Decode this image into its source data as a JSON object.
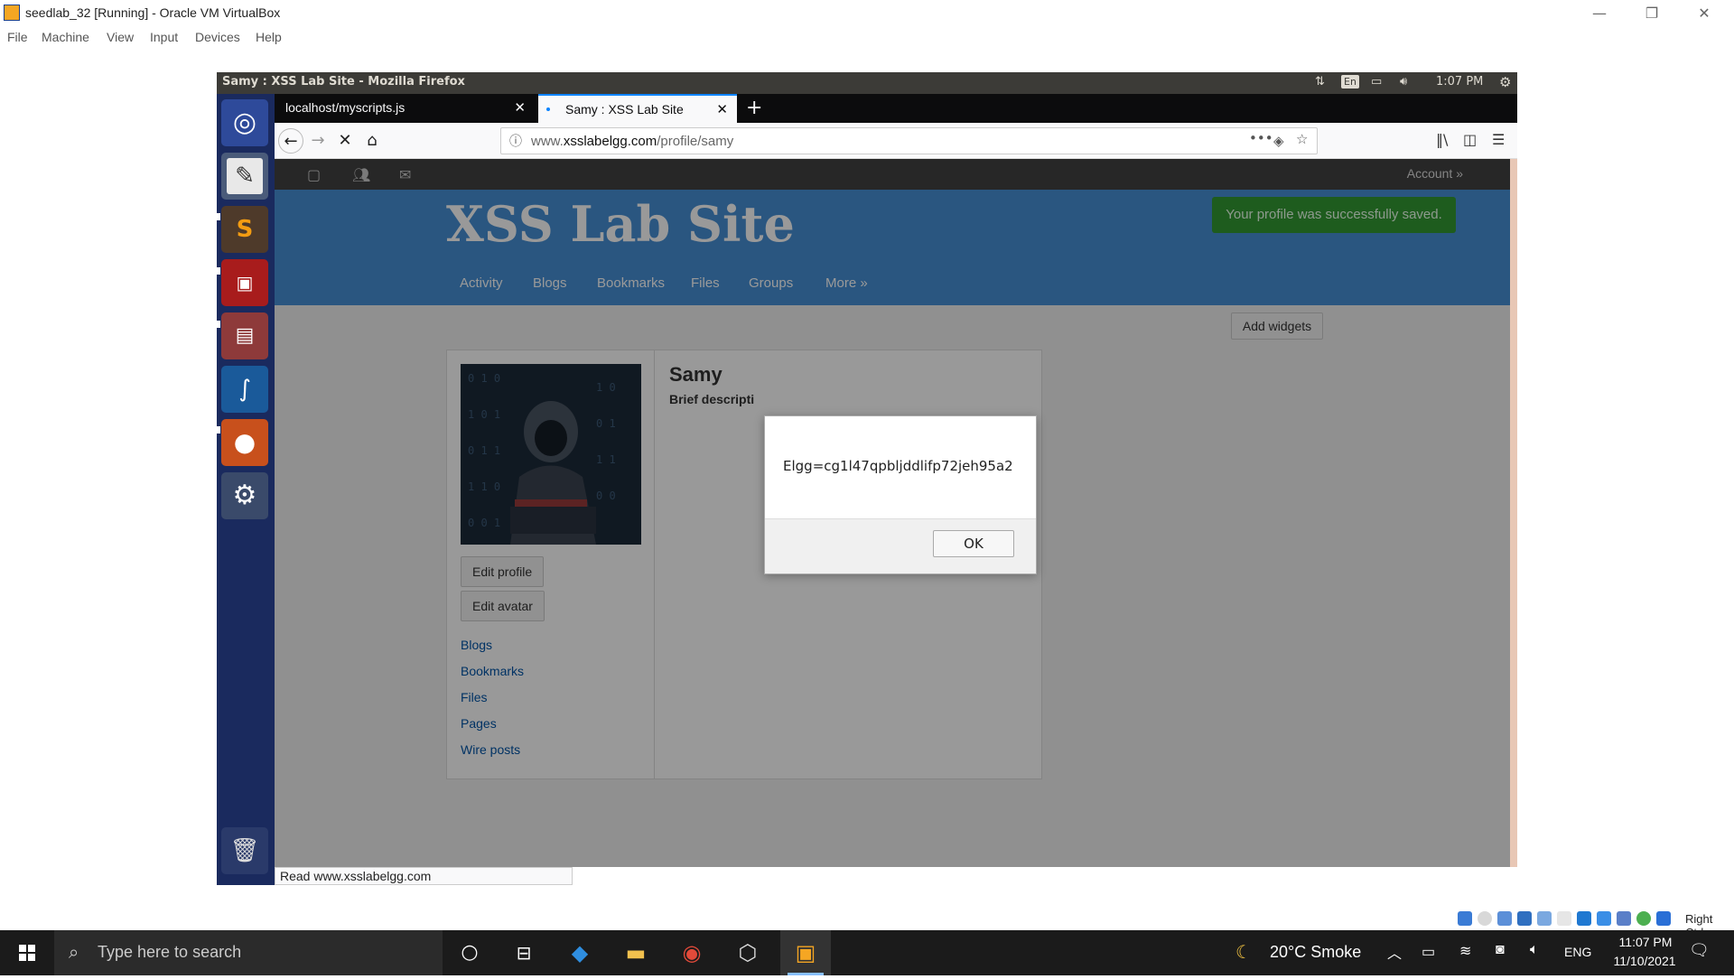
{
  "vbox": {
    "title": "seedlab_32 [Running] - Oracle VM VirtualBox",
    "menu": [
      "File",
      "Machine",
      "View",
      "Input",
      "Devices",
      "Help"
    ],
    "controls": {
      "minimize": "—",
      "restore": "❐",
      "close": "✕"
    },
    "host_key_label": "Right Ctrl"
  },
  "ubuntu_panel": {
    "window_title": "Samy : XSS Lab Site - Mozilla Firefox",
    "keyboard": "En",
    "time": "1:07 PM"
  },
  "launcher": {
    "items": [
      "ubuntu-dash-icon",
      "text-editor-icon",
      "sublime-text-icon",
      "terminal-icon",
      "files-icon",
      "wireshark-icon",
      "firefox-icon",
      "system-settings-icon"
    ],
    "trash": "trash-icon"
  },
  "firefox": {
    "tabs": [
      {
        "label": "localhost/myscripts.js",
        "close": "✕"
      },
      {
        "label": "Samy : XSS Lab Site",
        "close": "✕"
      }
    ],
    "new_tab": "+",
    "url_prefix": "www.",
    "url_domain": "xsslabelgg.com",
    "url_path": "/profile/samy",
    "status_text": "Read www.xsslabelgg.com"
  },
  "site": {
    "account_link": "Account »",
    "title": "XSS Lab Site",
    "success_message": "Your profile was successfully saved.",
    "nav": [
      "Activity",
      "Blogs",
      "Bookmarks",
      "Files",
      "Groups",
      "More »"
    ],
    "add_widgets": "Add widgets",
    "profile": {
      "name": "Samy",
      "brief_description_label": "Brief descripti",
      "edit_profile": "Edit profile",
      "edit_avatar": "Edit avatar",
      "links": [
        "Blogs",
        "Bookmarks",
        "Files",
        "Pages",
        "Wire posts"
      ]
    }
  },
  "alert": {
    "message": "Elgg=cg1l47qpbljddlifp72jeh95a2",
    "ok": "OK"
  },
  "taskbar": {
    "search_placeholder": "Type here to search",
    "weather": "20°C  Smoke",
    "language": "ENG",
    "time": "11:07 PM",
    "date": "11/10/2021"
  }
}
